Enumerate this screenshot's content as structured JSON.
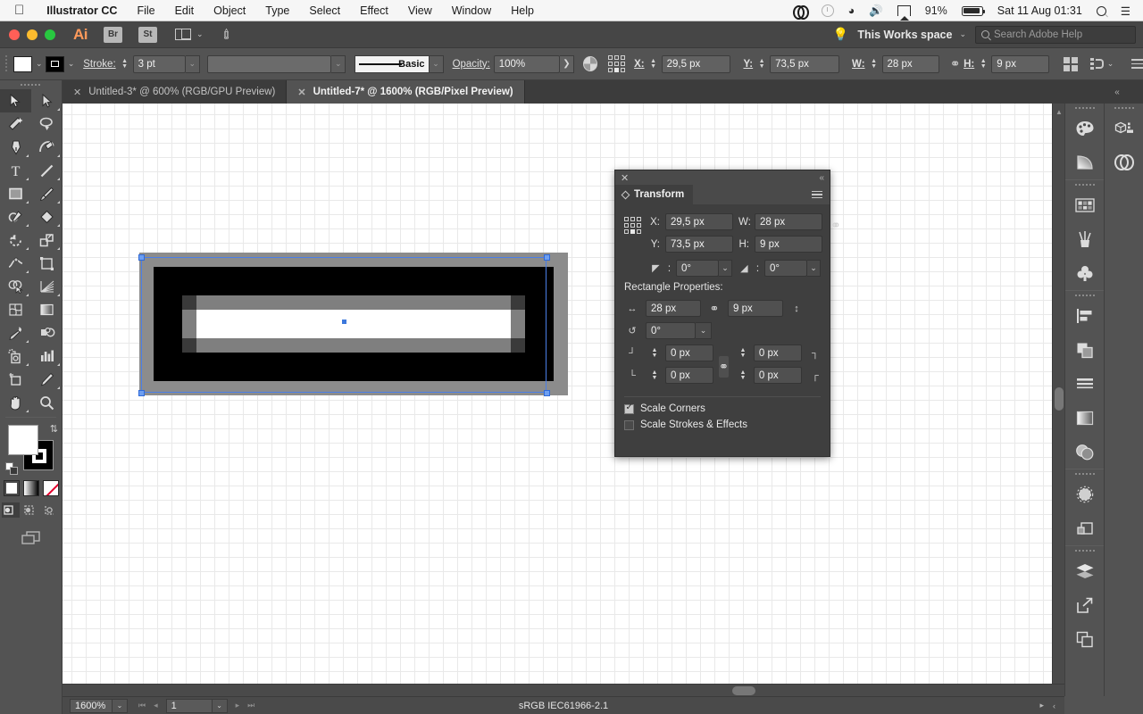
{
  "menubar": {
    "apple_icon": "apple-icon",
    "app_name": "Illustrator CC",
    "items": [
      "File",
      "Edit",
      "Object",
      "Type",
      "Select",
      "Effect",
      "View",
      "Window",
      "Help"
    ],
    "status": {
      "creative_cloud_icon": "creative-cloud-icon",
      "time_machine_icon": "time-machine-icon",
      "wifi_icon": "wifi-icon",
      "volume_icon": "volume-icon",
      "airplay_icon": "airplay-icon",
      "battery_percent": "91%",
      "battery_icon": "battery-icon",
      "datetime": "Sat 11 Aug  01:31",
      "spotlight_icon": "spotlight-search-icon",
      "notification_icon": "notification-center-icon"
    }
  },
  "appbar": {
    "logo": "Ai",
    "bridge_label": "Br",
    "stock_label": "St",
    "arrange_icon": "arrange-documents-icon",
    "arrange_chevron": "⌄",
    "rocket_icon": "launch-icon",
    "bulb_icon": "lightbulb-icon",
    "workspace": "This Works space",
    "workspace_chevron": "⌄",
    "search_placeholder": "Search Adobe Help",
    "search_icon": "search-icon"
  },
  "controlbar": {
    "fill_label": "fill-swatch",
    "fill_color": "#ffffff",
    "stroke_label": "stroke-swatch",
    "stroke_color": "#000000",
    "stroke_text": "Stroke:",
    "stroke_weight": "3 pt",
    "variable_width_placeholder": "",
    "brush_label": "Basic",
    "opacity_text": "Opacity:",
    "opacity_value": "100%",
    "opacity_arrow": "❯",
    "transparency_icon": "opacity-mask-icon",
    "reference_point_icon": "reference-point-selector",
    "x_label": "X:",
    "x_value": "29,5 px",
    "y_label": "Y:",
    "y_value": "73,5 px",
    "w_label": "W:",
    "w_value": "28 px",
    "h_label": "H:",
    "h_value": "9 px",
    "link_icon": "unlink-proportions-icon",
    "align_icon": "align-icon",
    "distribute_icon": "distribute-icon",
    "distribute_chevron": "⌄",
    "options_icon": "more-options-icon"
  },
  "tabs": [
    {
      "title": "Untitled-3* @ 600% (RGB/GPU Preview)",
      "active": false,
      "close_icon": "close-tab-icon"
    },
    {
      "title": "Untitled-7* @ 1600% (RGB/Pixel Preview)",
      "active": true,
      "close_icon": "close-tab-icon"
    }
  ],
  "tabs_collapse_icon": "collapse-dock-icon",
  "toolbar": {
    "tools": [
      {
        "name": "selection-tool",
        "selected": true,
        "has_flyout": false
      },
      {
        "name": "direct-selection-tool",
        "selected": false,
        "has_flyout": true
      },
      {
        "name": "magic-wand-tool",
        "selected": false,
        "has_flyout": false
      },
      {
        "name": "lasso-tool",
        "selected": false,
        "has_flyout": false
      },
      {
        "name": "pen-tool",
        "selected": false,
        "has_flyout": true
      },
      {
        "name": "curvature-tool",
        "selected": false,
        "has_flyout": true
      },
      {
        "name": "type-tool",
        "selected": false,
        "has_flyout": true
      },
      {
        "name": "line-segment-tool",
        "selected": false,
        "has_flyout": true
      },
      {
        "name": "rectangle-tool",
        "selected": false,
        "has_flyout": true
      },
      {
        "name": "paintbrush-tool",
        "selected": false,
        "has_flyout": true
      },
      {
        "name": "shaper-tool",
        "selected": false,
        "has_flyout": true
      },
      {
        "name": "eraser-tool",
        "selected": false,
        "has_flyout": true
      },
      {
        "name": "rotate-tool",
        "selected": false,
        "has_flyout": true
      },
      {
        "name": "scale-tool",
        "selected": false,
        "has_flyout": true
      },
      {
        "name": "width-tool",
        "selected": false,
        "has_flyout": true
      },
      {
        "name": "free-transform-tool",
        "selected": false,
        "has_flyout": false
      },
      {
        "name": "shape-builder-tool",
        "selected": false,
        "has_flyout": true
      },
      {
        "name": "perspective-grid-tool",
        "selected": false,
        "has_flyout": true
      },
      {
        "name": "mesh-tool",
        "selected": false,
        "has_flyout": false
      },
      {
        "name": "gradient-tool",
        "selected": false,
        "has_flyout": false
      },
      {
        "name": "eyedropper-tool",
        "selected": false,
        "has_flyout": true
      },
      {
        "name": "blend-tool",
        "selected": false,
        "has_flyout": false
      },
      {
        "name": "symbol-sprayer-tool",
        "selected": false,
        "has_flyout": true
      },
      {
        "name": "column-graph-tool",
        "selected": false,
        "has_flyout": true
      },
      {
        "name": "artboard-tool",
        "selected": false,
        "has_flyout": false
      },
      {
        "name": "slice-tool",
        "selected": false,
        "has_flyout": true
      },
      {
        "name": "hand-tool",
        "selected": false,
        "has_flyout": true
      },
      {
        "name": "zoom-tool",
        "selected": false,
        "has_flyout": false
      }
    ],
    "fill_color": "#ffffff",
    "stroke_color": "#000000",
    "swap_icon": "swap-fill-stroke-icon",
    "default_icon": "default-fill-stroke-icon",
    "color_mode_icon": "color-icon",
    "gradient_mode_icon": "gradient-icon",
    "none_mode_icon": "none-icon",
    "draw_normal_icon": "draw-normal-icon",
    "draw_behind_icon": "draw-behind-icon",
    "draw_inside_icon": "draw-inside-icon",
    "screen_mode_icon": "change-screen-mode-icon"
  },
  "transform_panel": {
    "close_icon": "close-panel-icon",
    "collapse_icon": "collapse-panel-icon",
    "title": "Transform",
    "menu_icon": "panel-menu-icon",
    "reference_point_icon": "reference-point-selector",
    "x_label": "X:",
    "x_value": "29,5 px",
    "y_label": "Y:",
    "y_value": "73,5 px",
    "w_label": "W:",
    "w_value": "28 px",
    "h_label": "H:",
    "h_value": "9 px",
    "constrain_icon": "unlink-wh-icon",
    "angle_icon": "rotate-angle-icon",
    "angle_value": "0°",
    "shear_icon": "shear-angle-icon",
    "shear_value": "0°",
    "section_title": "Rectangle Properties:",
    "rect_width_icon": "rect-width-icon",
    "rect_width": "28 px",
    "rect_link_icon": "unlink-rect-wh-icon",
    "rect_height": "9 px",
    "rect_height_icon": "rect-height-icon",
    "rect_angle_icon": "rect-rotate-icon",
    "rect_angle": "0°",
    "corner_tl_icon": "corner-top-left-icon",
    "corner_tl": "0 px",
    "corner_tr": "0 px",
    "corner_tr_icon": "corner-top-right-icon",
    "corner_bl_icon": "corner-bottom-left-icon",
    "corner_bl": "0 px",
    "corner_br": "0 px",
    "corner_br_icon": "corner-bottom-right-icon",
    "corner_link_icon": "link-corner-radii-icon",
    "scale_corners_label": "Scale Corners",
    "scale_corners_checked": true,
    "scale_strokes_label": "Scale Strokes & Effects",
    "scale_strokes_checked": false
  },
  "dock": {
    "col_left": [
      "color-panel-icon",
      "gradient-panel-icon",
      "swatches-panel-icon",
      "brushes-panel-icon",
      "symbols-panel-icon",
      "align-panel-icon",
      "pathfinder-panel-icon",
      "stroke-panel-icon",
      "gradient2-panel-icon",
      "transparency-panel-icon",
      "appearance-panel-icon",
      "graphic-styles-panel-icon",
      "layers-panel-icon",
      "asset-export-panel-icon",
      "artboards-panel-icon"
    ],
    "col_right": [
      "asset-export-icon",
      "cc-libraries-icon"
    ]
  },
  "statusbar": {
    "zoom_value": "1600%",
    "zoom_chevron": "⌄",
    "first_page_icon": "first-artboard-icon",
    "prev_page_icon": "previous-artboard-icon",
    "page_value": "1",
    "page_chevron": "⌄",
    "next_page_icon": "next-artboard-icon",
    "last_page_icon": "last-artboard-icon",
    "color_profile": "sRGB IEC61966-2.1",
    "play_icon": "status-menu-icon",
    "resize_icon": "status-expand-icon"
  },
  "canvas": {
    "artwork_name": "pixel-preview-rectangle",
    "selection_color": "#4a7fe8",
    "pixel_rows": [
      "gggggggggggggggggggggggggggggg",
      "gkkkkkkkkkkkkkkkkkkkkkkkkkkkkg",
      "gkkkkkkkkkkkkkkkkkkkkkkkkkkkkg",
      "gkkdmmmmmmmmmmmmmmmmmmmmmmdkkg",
      "gkkmwwwwwwwwwwwwwwwwwwwwwwmkkg",
      "gkkmwwwwwwwwwwwwwwwwwwwwwwmkkg",
      "gkkdmmmmmmmmmmmmmmmmmmmmmmdkkg",
      "gkkkkkkkkkkkkkkkkkkkkkkkkkkkkg",
      "gkkkkkkkkkkkkkkkkkkkkkkkkkkkkg",
      "gggggggggggggggggggggggggggggg"
    ],
    "palette": {
      "g": "#8c8c8c",
      "k": "#000000",
      "m": "#7f7f7f",
      "d": "#3a3a3a",
      "w": "#ffffff"
    }
  }
}
